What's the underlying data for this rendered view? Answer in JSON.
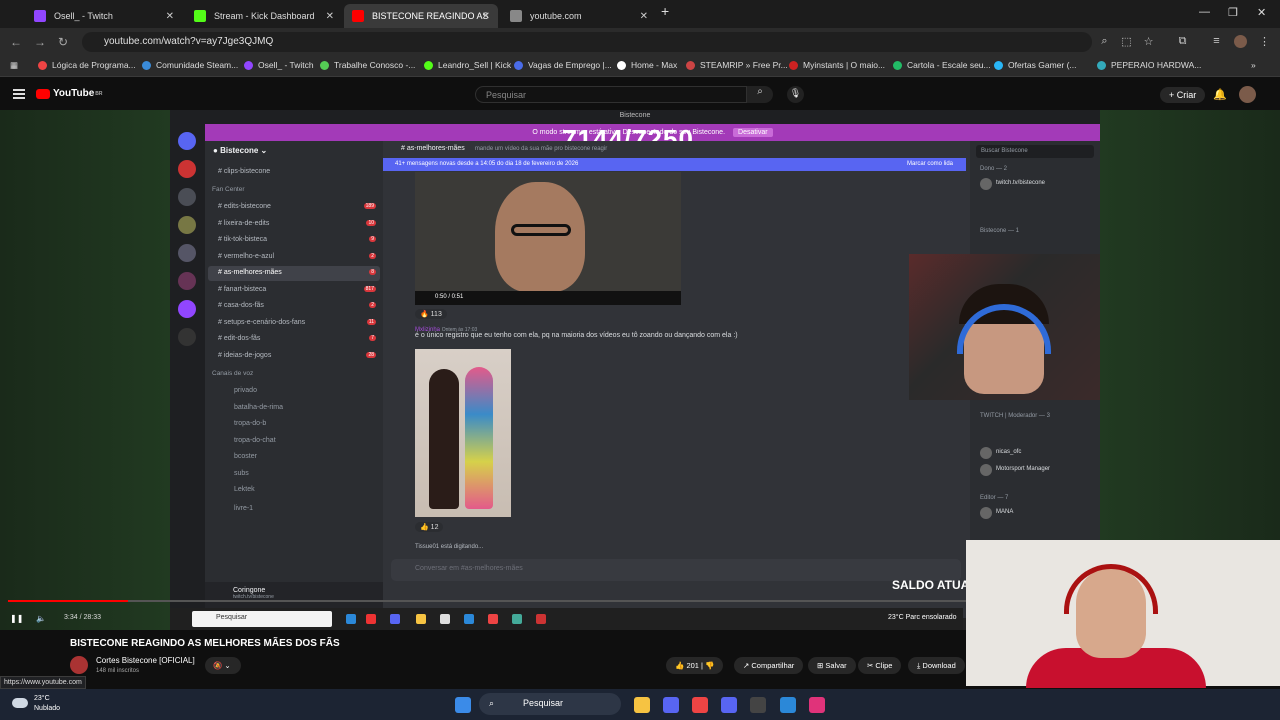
{
  "browser": {
    "tabs": [
      {
        "title": "Osell_ - Twitch",
        "color": "#9146ff"
      },
      {
        "title": "Stream - Kick Dashboard",
        "color": "#53fc18"
      },
      {
        "title": "BISTECONE REAGINDO AS",
        "color": "#ff0000"
      },
      {
        "title": "youtube.com",
        "color": "#888888"
      }
    ],
    "url": "youtube.com/watch?v=ay7Jge3QJMQ",
    "bookmarks": [
      "Lógica de Programa...",
      "Comunidade Steam...",
      "Osell_ - Twitch",
      "Trabalhe Conosco -...",
      "Leandro_Sell | Kick",
      "Vagas de Emprego |...",
      "Home - Max",
      "STEAMRIP » Free Pr...",
      "Myinstants | O maio...",
      "Cartola - Escale seu...",
      "Ofertas Gamer (...",
      "PEPERAIO HARDWA..."
    ]
  },
  "youtube": {
    "logo": "YouTube",
    "region": "BR",
    "search_placeholder": "Pesquisar",
    "create_label": "Criar",
    "video_title": "BISTECONE REAGINDO AS MELHORES MÃES DOS FÃS",
    "channel": "Cortes Bistecone [OFICIAL]",
    "subscribers": "148 mil inscritos",
    "likes": "201",
    "share": "Compartilhar",
    "save": "Salvar",
    "clip": "Clipe",
    "download": "Download",
    "time": "3:34 / 28:33",
    "progress": 0.125,
    "status_url": "https://www.youtube.com"
  },
  "discord": {
    "title": "Bistecone",
    "counter": "7144/7250",
    "banner_text": "O modo streamer está ativo. Desconectado do seu Bistecone.",
    "banner_button": "Desativar",
    "server": "Bistecone",
    "top_channel": "clips-bistecone",
    "category_fan": "Fan Center",
    "channels": [
      {
        "name": "edits-bistecone",
        "badge": "189"
      },
      {
        "name": "lixeira-de-edits",
        "badge": "10"
      },
      {
        "name": "tik-tok-bisteca",
        "badge": "9"
      },
      {
        "name": "vermelho-e-azul",
        "badge": "2"
      },
      {
        "name": "as-melhores-mães",
        "badge": "8"
      },
      {
        "name": "fanart-bisteca",
        "badge": "817"
      },
      {
        "name": "casa-dos-fãs",
        "badge": "2"
      },
      {
        "name": "setups-e-cenário-dos-fans",
        "badge": "11"
      },
      {
        "name": "edit-dos-fãs",
        "badge": "7"
      },
      {
        "name": "ideias-de-jogos",
        "badge": "28"
      }
    ],
    "voice_category": "Canais de voz",
    "voice_channels": [
      "privado",
      "batalha-de-rima",
      "tropa-do-b",
      "tropa-do-chat",
      "bcoster",
      "subs",
      "Lektek",
      "livre-1"
    ],
    "user": "Coringone",
    "user_status": "twitch.tv/bistecone",
    "channel_header": "as-melhores-mães",
    "channel_topic": "mande um vídeo da sua mãe pro bistecone reagir",
    "new_messages": "41+ mensagens novas desde a 14:05 do dia 18 de fevereiro de 2026",
    "mark_read": "Marcar como lida",
    "video_time": "0:50 / 0:51",
    "reaction1": "113",
    "msg_user": "Mxlizinha",
    "msg_time": "Ontem às 17:03",
    "msg_text": "é o único registro que eu tenho com ela, pq na maioria dos vídeos eu tô zoando ou dançando com ela :)",
    "reaction2": "12",
    "typing": "Tissue01 está digitando...",
    "input_placeholder": "Conversar em #as-melhores-mães",
    "member_search": "Buscar Bistecone",
    "member_groups": [
      "Dono — 2",
      "Bistecone — 1",
      "TWITCH | Moderador — 3",
      "Editor — 7"
    ],
    "members": [
      "twitch.tv/bistecone",
      "nicas_ofc",
      "Motorsport Manager",
      "MANA"
    ],
    "saldo": "SALDO ATUAL",
    "win_search": "Pesquisar",
    "win_weather": "23°C  Parc ensolarado"
  },
  "taskbar": {
    "temp": "23°C",
    "condition": "Nublado",
    "search": "Pesquisar"
  }
}
